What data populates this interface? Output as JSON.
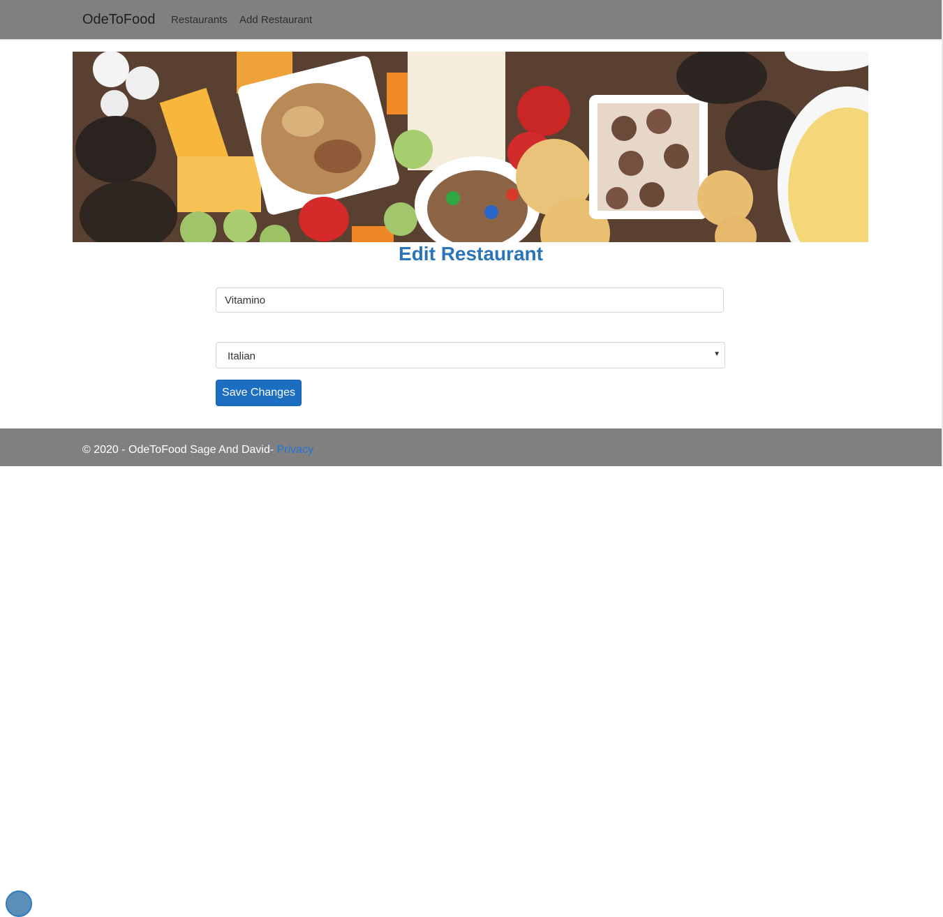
{
  "navbar": {
    "brand": "OdeToFood",
    "links": [
      "Restaurants",
      "Add Restaurant"
    ]
  },
  "page": {
    "title": "Edit Restaurant"
  },
  "form": {
    "name_value": "Vitamino",
    "cuisine_selected": "Italian",
    "save_label": "Save Changes"
  },
  "footer": {
    "text": "© 2020 - OdeToFood Sage And David- ",
    "privacy_label": "Privacy"
  },
  "colors": {
    "navbar_bg": "#808080",
    "title_blue": "#2a74b9",
    "button_blue": "#1b6ec2",
    "link_blue": "#1f74d6"
  }
}
